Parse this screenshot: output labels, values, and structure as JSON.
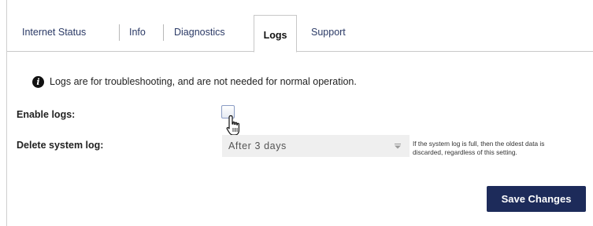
{
  "tabs": [
    {
      "label": "Internet Status",
      "active": false
    },
    {
      "label": "Info",
      "active": false
    },
    {
      "label": "Diagnostics",
      "active": false
    },
    {
      "label": "Logs",
      "active": true
    },
    {
      "label": "Support",
      "active": false
    }
  ],
  "info": {
    "icon": "info-icon",
    "glyph": "i",
    "message": "Logs are for troubleshooting, and are not needed for normal operation."
  },
  "enable_logs": {
    "label": "Enable logs:",
    "checked": false
  },
  "delete_log": {
    "label": "Delete system log:",
    "selected": "After 3 days",
    "help": "If the system log is full, then the oldest data is discarded, regardless of this setting."
  },
  "actions": {
    "save_label": "Save Changes"
  },
  "colors": {
    "accent": "#1d2b5a",
    "tab_text": "#2b3a66",
    "select_bg": "#efefef"
  }
}
